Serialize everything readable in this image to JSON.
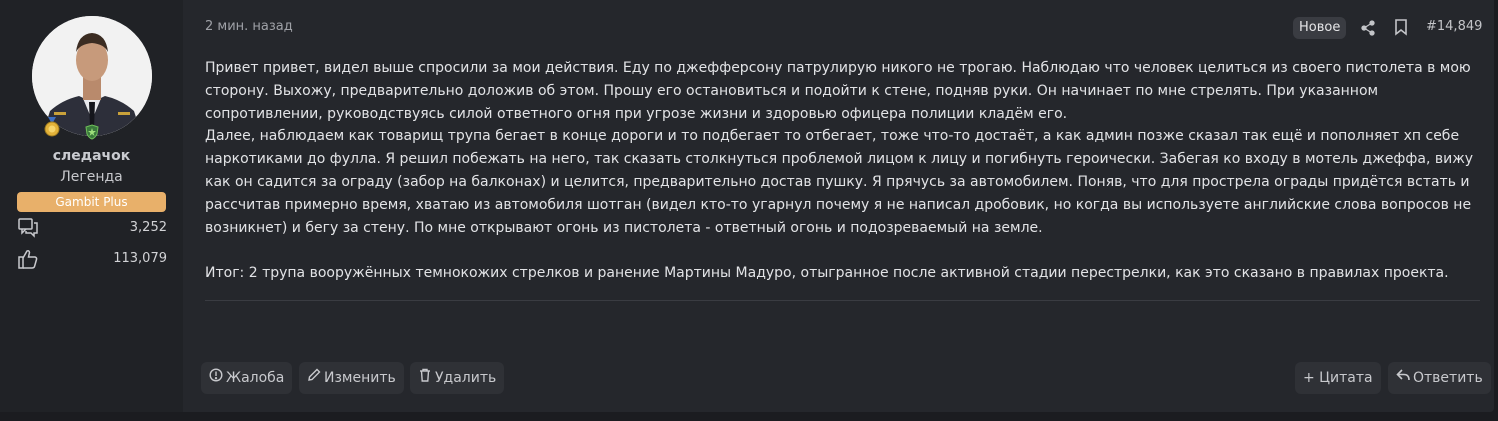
{
  "user": {
    "name": "следачок",
    "title": "Легенда",
    "banner": "Gambit Plus",
    "messages": "3,252",
    "reactions": "113,079"
  },
  "post": {
    "time": "2 мин. назад",
    "new_label": "Новое",
    "number": "#14,849",
    "paragraphs": [
      "Привет привет, видел выше спросили за мои действия. Еду по джефферсону патрулирую никого не трогаю. Наблюдаю что человек целиться из своего пистолета в мою сторону. Выхожу, предварительно доложив об этом. Прошу его остановиться и подойти к стене, подняв руки. Он начинает по мне стрелять. При указанном сопротивлении, руководствуясь силой ответного огня при угрозе жизни и здоровью офицера полиции кладём его.",
      "Далее, наблюдаем как товарищ трупа бегает в конце дороги и то подбегает то отбегает, тоже что-то достаёт, а как админ позже сказал так ещё и пополняет хп себе наркотиками до фулла. Я решил побежать на него, так сказать столкнуться проблемой лицом к лицу и погибнуть героически. Забегая ко входу в мотель джеффа, вижу как он садится за ограду (забор на балконах) и целится, предварительно достав пушку. Я прячусь за автомобилем. Поняв, что для прострела ограды придётся встать и рассчитав примерно время, хватаю из автомобиля шотган (видел кто-то угарнул почему я не написал дробовик, но когда вы используете английские слова вопросов не возникнет) и бегу за стену. По мне открывают огонь из пистолета - ответный огонь и подозреваемый на земле.",
      "Итог: 2 трупа вооружённых темнокожих стрелков и ранение Мартины Мадуро, отыгранное после активной стадии перестрелки, как это сказано в правилах проекта."
    ]
  },
  "actions": {
    "report": "Жалоба",
    "edit": "Изменить",
    "delete": "Удалить",
    "quote": "+ Цитата",
    "reply": "Ответить"
  },
  "colors": {
    "page_bg": "#1b1c20",
    "post_bg": "#25272c",
    "user_col_bg": "#202226",
    "banner": "#e8b06a",
    "button_bg": "#2f3136"
  },
  "icons": [
    "medal-icon",
    "shield-icon",
    "messages-icon",
    "like-icon",
    "share-icon",
    "bookmark-icon",
    "alert-circle-icon",
    "pencil-icon",
    "trash-icon",
    "reply-icon"
  ]
}
